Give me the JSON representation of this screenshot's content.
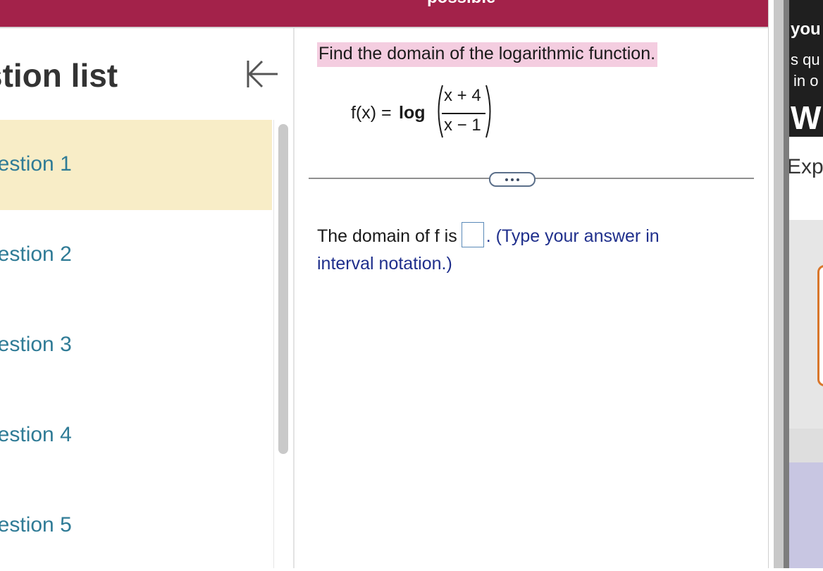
{
  "header": {
    "partial_text": "possible"
  },
  "sidebar": {
    "title": "stion list",
    "items": [
      {
        "label": "uestion 1",
        "active": true
      },
      {
        "label": "uestion 2",
        "active": false
      },
      {
        "label": "uestion 3",
        "active": false
      },
      {
        "label": "uestion 4",
        "active": false
      },
      {
        "label": "uestion 5",
        "active": false
      }
    ]
  },
  "question": {
    "prompt": "Find the domain of the logarithmic function.",
    "formula": {
      "lhs": "f(x) =",
      "func": "log",
      "numerator": "x + 4",
      "denominator": "x − 1"
    },
    "answer_prefix": "The domain of f is",
    "answer_value": "",
    "answer_hint": ". (Type your answer in interval notation.)"
  },
  "right_panel": {
    "text_you": "you",
    "text_line1": "s qu",
    "text_line2": "in o",
    "text_w": "W",
    "text_exp": "Exp"
  },
  "colors": {
    "header_bg": "#a3224a",
    "active_item_bg": "#f8edc7",
    "question_link": "#2f7b96",
    "prompt_highlight": "#f4cde0",
    "hint_text": "#1f2f8c"
  }
}
